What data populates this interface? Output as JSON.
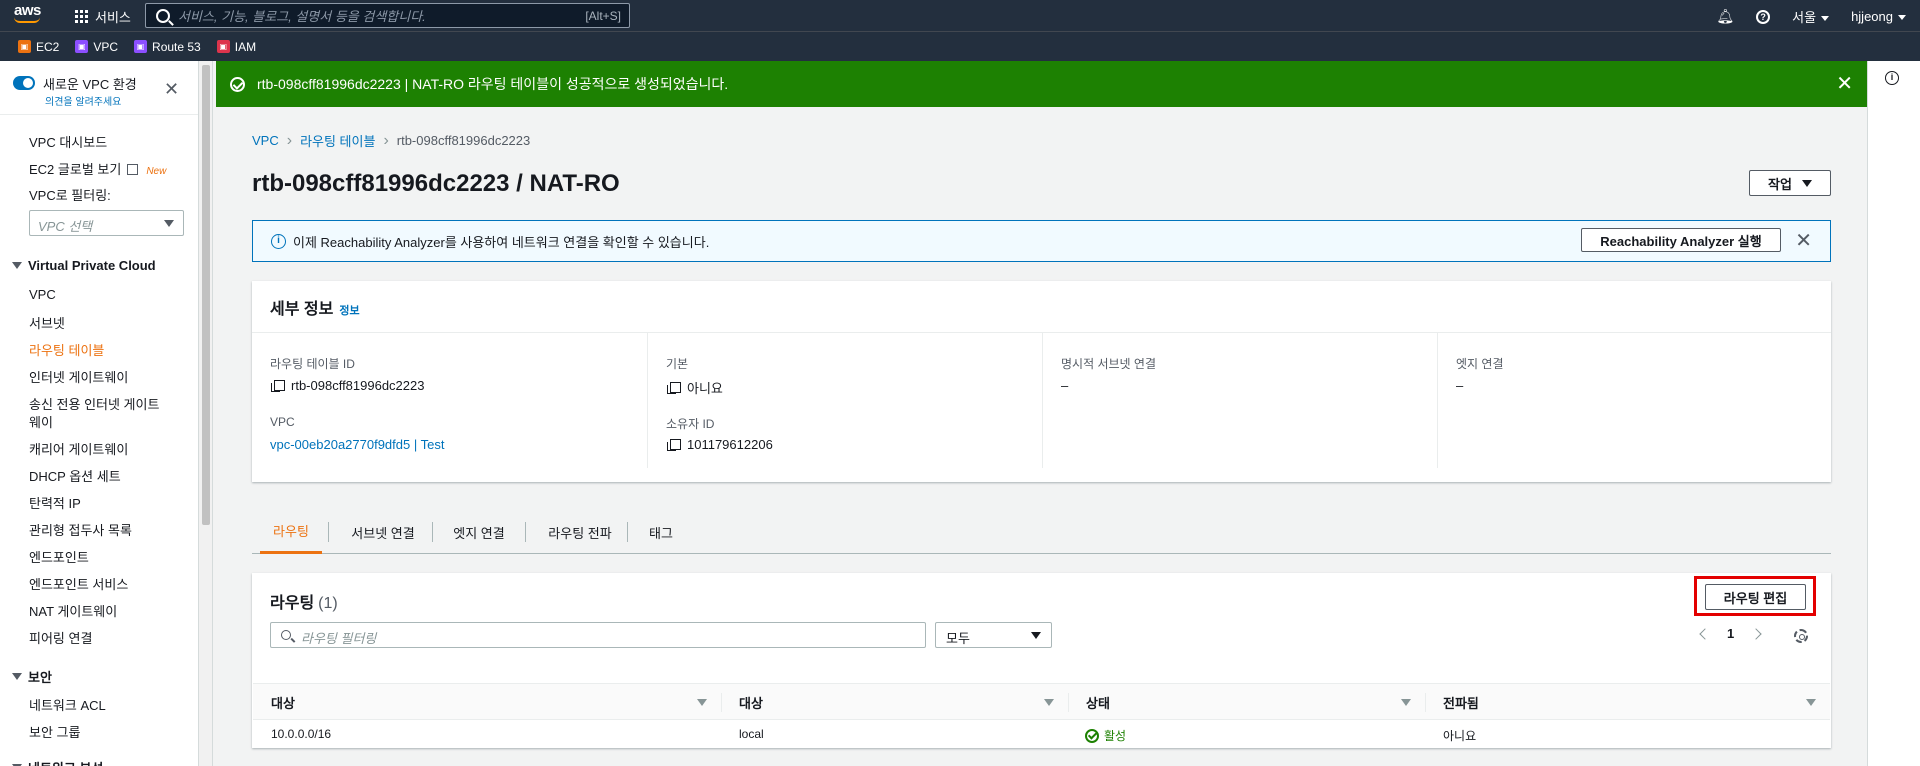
{
  "topnav": {
    "logo": "aws",
    "services_label": "서비스",
    "search_placeholder": "서비스, 기능, 블로그, 설명서 등을 검색합니다.",
    "search_shortcut": "[Alt+S]",
    "region_label": "서울",
    "user_label": "hjjeong"
  },
  "favorites": [
    {
      "label": "EC2",
      "color": "#ec7211"
    },
    {
      "label": "VPC",
      "color": "#8c4fff"
    },
    {
      "label": "Route 53",
      "color": "#8c4fff"
    },
    {
      "label": "IAM",
      "color": "#dd344c"
    }
  ],
  "sidebar": {
    "toggle_title": "새로운 VPC 환경",
    "toggle_sub": "의견을 알려주세요",
    "dashboard": "VPC 대시보드",
    "ec2_global": "EC2 글로벌 보기",
    "new_badge": "New",
    "filter_label": "VPC로 필터링:",
    "filter_placeholder": "VPC 선택",
    "section_vpc": "Virtual Private Cloud",
    "items": [
      "VPC",
      "서브넷",
      "라우팅 테이블",
      "인터넷 게이트웨이",
      "송신 전용 인터넷 게이트",
      "웨이",
      "캐리어 게이트웨이",
      "DHCP 옵션 세트",
      "탄력적 IP",
      "관리형 접두사 목록",
      "엔드포인트",
      "엔드포인트 서비스",
      "NAT 게이트웨이",
      "피어링 연결"
    ],
    "section_security": "보안",
    "security_items": [
      "네트워크 ACL",
      "보안 그룹"
    ],
    "section_next": "네트워크 분석"
  },
  "flash": {
    "message": "rtb-098cff81996dc2223 | NAT-RO 라우팅 테이블이 성공적으로 생성되었습니다."
  },
  "breadcrumb": {
    "items": [
      "VPC",
      "라우팅 테이블",
      "rtb-098cff81996dc2223"
    ]
  },
  "page": {
    "title": "rtb-098cff81996dc2223 / NAT-RO",
    "actions_label": "작업"
  },
  "info_banner": {
    "text": "이제 Reachability Analyzer를 사용하여 네트워크 연결을 확인할 수 있습니다.",
    "button": "Reachability Analyzer 실행"
  },
  "details": {
    "title": "세부 정보",
    "info_link": "정보",
    "rt_id_label": "라우팅 테이블 ID",
    "rt_id": "rtb-098cff81996dc2223",
    "vpc_label": "VPC",
    "vpc_value": "vpc-00eb20a2770f9dfd5 | Test",
    "main_label": "기본",
    "main_value": "아니요",
    "owner_label": "소유자 ID",
    "owner_value": "101179612206",
    "explicit_label": "명시적 서브넷 연결",
    "explicit_value": "–",
    "edge_label": "엣지 연결",
    "edge_value": "–"
  },
  "tabs": [
    "라우팅",
    "서브넷 연결",
    "엣지 연결",
    "라우팅 전파",
    "태그"
  ],
  "routes": {
    "title": "라우팅",
    "count": "(1)",
    "edit_button": "라우팅 편집",
    "filter_placeholder": "라우팅 필터링",
    "filter_select": "모두",
    "page": "1",
    "columns": [
      "대상",
      "대상",
      "상태",
      "전파됨"
    ],
    "rows": [
      [
        "10.0.0.0/16",
        "local",
        "활성",
        "아니요"
      ]
    ]
  }
}
